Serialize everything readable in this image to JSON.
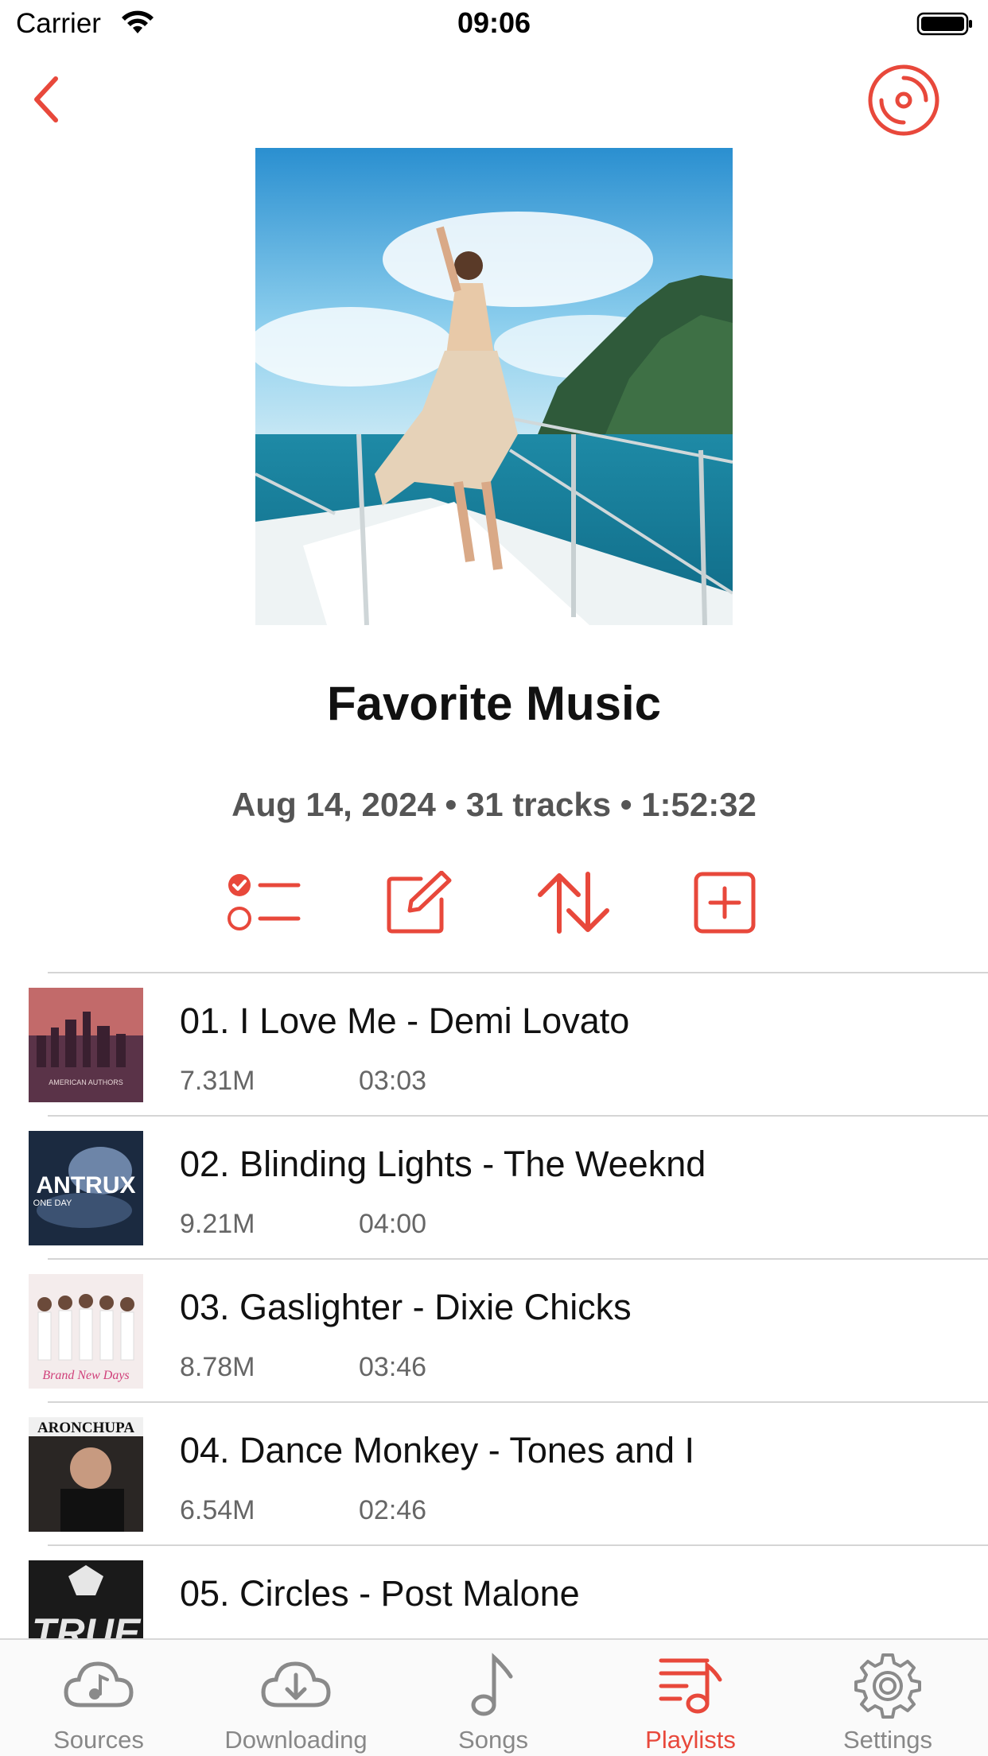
{
  "status_bar": {
    "carrier": "Carrier",
    "time": "09:06"
  },
  "colors": {
    "accent": "#e8483b",
    "text": "#111111",
    "secondary": "#666666",
    "divider": "#d5d5d5"
  },
  "nav": {
    "back_icon": "chevron-left-icon",
    "disc_icon": "disc-icon"
  },
  "playlist": {
    "title": "Favorite Music",
    "meta": "Aug 14, 2024 • 31 tracks • 1:52:32"
  },
  "actions": [
    {
      "name": "select-list-icon"
    },
    {
      "name": "edit-icon"
    },
    {
      "name": "sort-icon"
    },
    {
      "name": "add-icon"
    }
  ],
  "tracks": [
    {
      "title": "01. I Love Me - Demi Lovato",
      "size": "7.31M",
      "duration": "03:03"
    },
    {
      "title": "02. Blinding Lights - The Weeknd",
      "size": "9.21M",
      "duration": "04:00"
    },
    {
      "title": "03. Gaslighter - Dixie Chicks",
      "size": "8.78M",
      "duration": "03:46"
    },
    {
      "title": "04. Dance Monkey - Tones and I",
      "size": "6.54M",
      "duration": "02:46"
    },
    {
      "title": "05. Circles - Post Malone",
      "size": "",
      "duration": ""
    }
  ],
  "thumb_text": {
    "t1": "AMERICAN AUTHORS",
    "t2": "ANTRUX",
    "t2b": "ONE DAY",
    "t3": "Brand New Days",
    "t4": "ARONCHUPA",
    "t5": "TRUE"
  },
  "tabs": [
    {
      "label": "Sources",
      "icon": "cloud-music-icon",
      "active": false
    },
    {
      "label": "Downloading",
      "icon": "cloud-download-icon",
      "active": false
    },
    {
      "label": "Songs",
      "icon": "music-note-icon",
      "active": false
    },
    {
      "label": "Playlists",
      "icon": "playlist-icon",
      "active": true
    },
    {
      "label": "Settings",
      "icon": "gear-icon",
      "active": false
    }
  ]
}
